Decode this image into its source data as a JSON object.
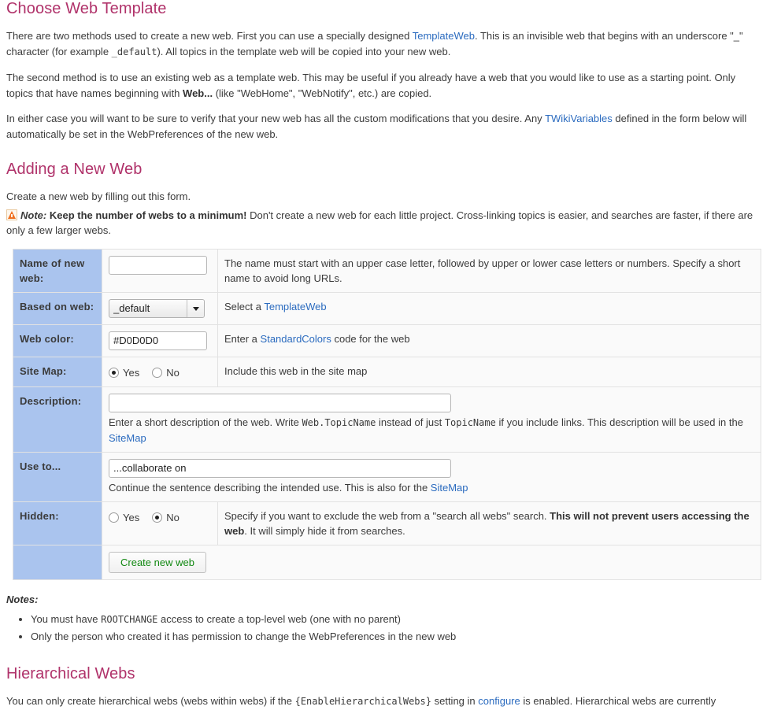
{
  "sections": {
    "choose_template": {
      "heading": "Choose Web Template",
      "p1_a": "There are two methods used to create a new web. First you can use a specially designed ",
      "p1_link": "TemplateWeb",
      "p1_b": ". This is an invisible web that begins with an underscore \"_\" character (for example ",
      "p1_code": "_default",
      "p1_c": "). All topics in the template web will be copied into your new web.",
      "p2_a": "The second method is to use an existing web as a template web. This may be useful if you already have a web that you would like to use as a starting point. Only topics that have names beginning with ",
      "p2_bold": "Web...",
      "p2_b": " (like \"WebHome\", \"WebNotify\", etc.) are copied.",
      "p3_a": "In either case you will want to be sure to verify that your new web has all the custom modifications that you desire. Any ",
      "p3_link": "TWikiVariables",
      "p3_b": " defined in the form below will automatically be set in the WebPreferences of the new web."
    },
    "adding_web": {
      "heading": "Adding a New Web",
      "intro": "Create a new web by filling out this form.",
      "note_icon": "warning-triangle-icon",
      "note_label": "Note:",
      "note_bold": "Keep the number of webs to a minimum!",
      "note_rest": " Don't create a new web for each little project. Cross-linking topics is easier, and searches are faster, if there are only a few larger webs."
    },
    "hierarchical": {
      "heading": "Hierarchical Webs",
      "p_a": "You can only create hierarchical webs (webs within webs) if the ",
      "p_code": "{EnableHierarchicalWebs}",
      "p_b": " setting in ",
      "p_link": "configure",
      "p_c": " is enabled. Hierarchical webs are currently"
    }
  },
  "form": {
    "name_of_new_web": {
      "label": "Name of new web:",
      "value": "",
      "hint_text": "The name must start with an upper case letter, followed by upper or lower case letters or numbers. Specify a short name to avoid long URLs."
    },
    "based_on_web": {
      "label": "Based on web:",
      "selected": "_default",
      "options": [
        "_default"
      ],
      "hint_a": "Select a ",
      "hint_link": "TemplateWeb"
    },
    "web_color": {
      "label": "Web color:",
      "value": "#D0D0D0",
      "hint_a": "Enter a ",
      "hint_link": "StandardColors",
      "hint_b": " code for the web"
    },
    "site_map": {
      "label": "Site Map:",
      "yes_label": "Yes",
      "no_label": "No",
      "selected": "Yes",
      "hint_text": "Include this web in the site map"
    },
    "description": {
      "label": "Description:",
      "value": "",
      "hint_a": "Enter a short description of the web. Write ",
      "hint_code1": "Web.TopicName",
      "hint_b": " instead of just ",
      "hint_code2": "TopicName",
      "hint_c": " if you include links. This description will be used in the ",
      "hint_link": "SiteMap"
    },
    "use_to": {
      "label": "Use to...",
      "value": "...collaborate on",
      "hint_a": "Continue the sentence describing the intended use. This is also for the ",
      "hint_link": "SiteMap"
    },
    "hidden": {
      "label": "Hidden:",
      "yes_label": "Yes",
      "no_label": "No",
      "selected": "No",
      "hint_a": "Specify if you want to exclude the web from a \"search all webs\" search. ",
      "hint_bold": "This will not prevent users accessing the web",
      "hint_b": ". It will simply hide it from searches."
    },
    "submit": {
      "label": "Create new web"
    }
  },
  "notes": {
    "heading": "Notes:",
    "items": [
      {
        "a": "You must have ",
        "code": "ROOTCHANGE",
        "b": " access to create a top-level web (one with no parent)"
      },
      {
        "a": "Only the person who created it has permission to change the WebPreferences in the new web",
        "code": "",
        "b": ""
      }
    ]
  },
  "colors": {
    "heading": "#b0326a",
    "link": "#2b6bbf",
    "label_cell_bg": "#aac4ee",
    "row_bg": "#fafafa",
    "button_text": "#118811",
    "warning": "#f07020"
  }
}
